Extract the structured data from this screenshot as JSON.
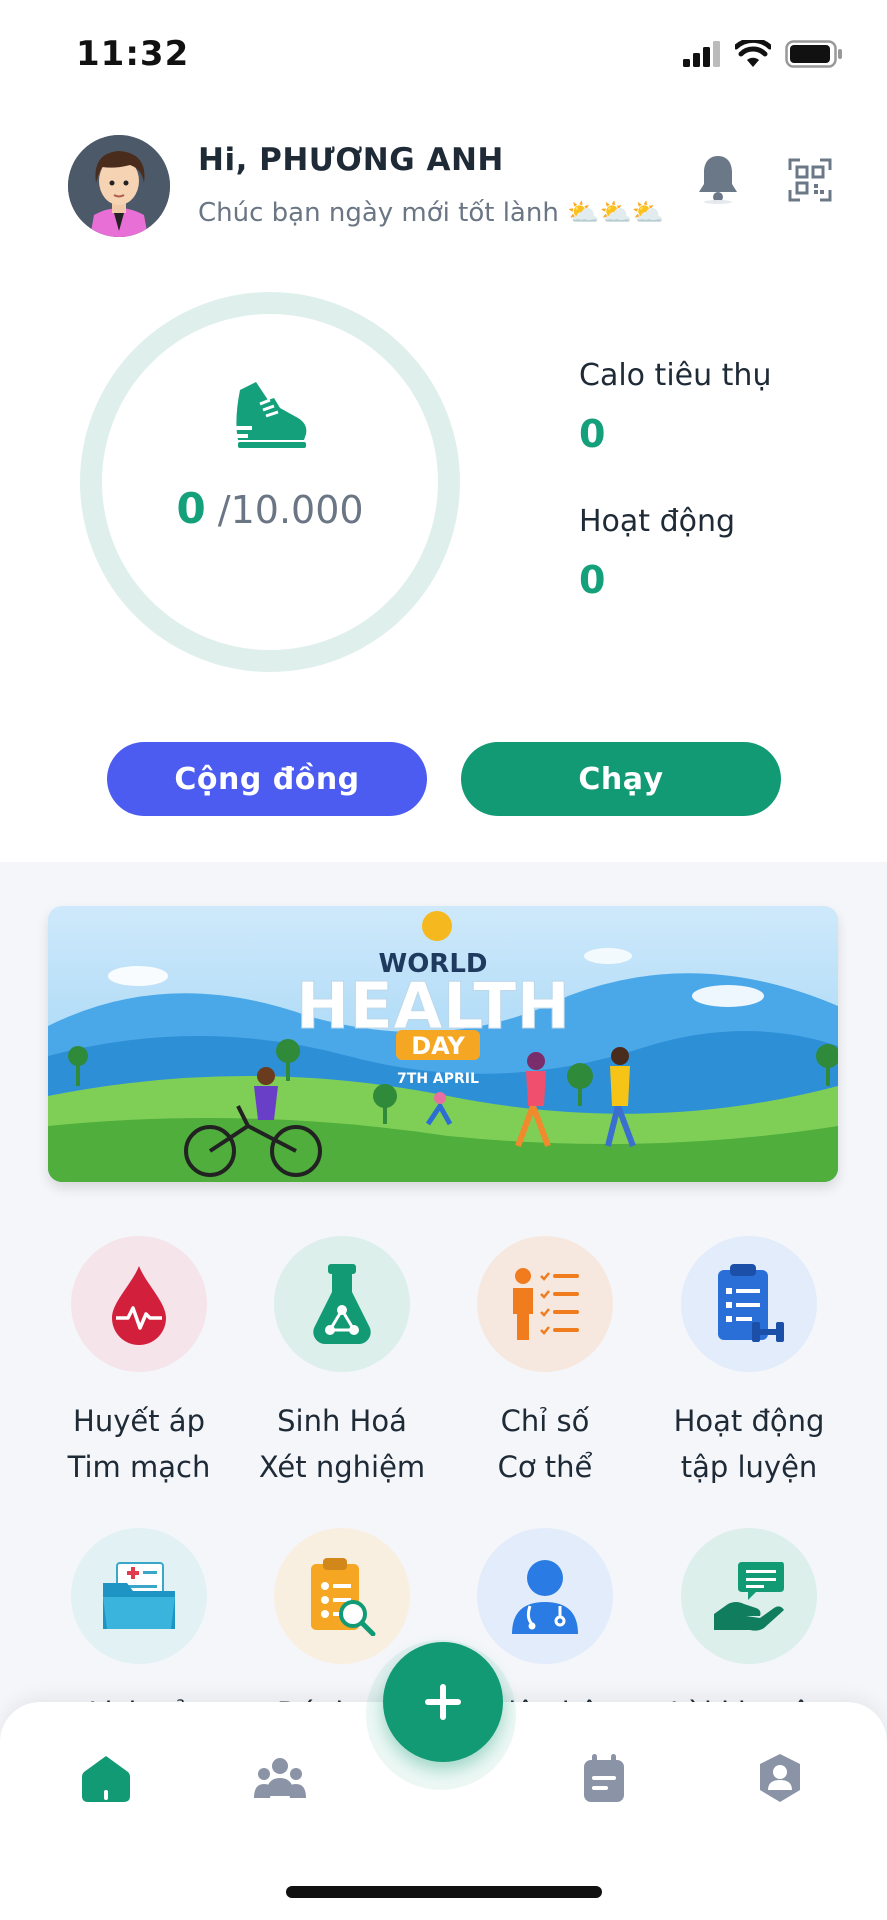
{
  "status_bar": {
    "time": "11:32"
  },
  "header": {
    "greeting": "Hi, PHƯƠNG ANH",
    "subtitle": "Chúc bạn ngày mới tốt lành ⛅⛅⛅"
  },
  "activity": {
    "steps_current": "0",
    "steps_goal": "/10.000",
    "steps_progress": 0,
    "calories_label": "Calo tiêu thụ",
    "calories_value": "0",
    "activity_label": "Hoạt động",
    "activity_value": "0"
  },
  "actions": {
    "community": "Cộng đồng",
    "run": "Chạy"
  },
  "banner": {
    "line1": "WORLD",
    "line2": "HEALTH",
    "line3": "DAY",
    "line4": "7TH APRIL"
  },
  "tiles": [
    {
      "line1": "Huyết áp",
      "line2": "Tim mạch",
      "icon": "blood-drop-icon",
      "bg": "#f5e4ea"
    },
    {
      "line1": "Sinh Hoá",
      "line2": "Xét nghiệm",
      "icon": "flask-icon",
      "bg": "#dcefea"
    },
    {
      "line1": "Chỉ số",
      "line2": "Cơ thể",
      "icon": "body-index-icon",
      "bg": "#f7e8df"
    },
    {
      "line1": "Hoạt động",
      "line2": "tập luyện",
      "icon": "clipboard-workout-icon",
      "bg": "#e2ecfb"
    },
    {
      "line1": "Lịch sử",
      "icon": "medical-folder-icon",
      "bg": "#e1f1f4"
    },
    {
      "line1": "Đánh giá",
      "icon": "assessment-icon",
      "bg": "#f8efe0"
    },
    {
      "line1": "Liên hệ",
      "icon": "doctor-icon",
      "bg": "#e2ecfb"
    },
    {
      "line1": "Lời khuyên",
      "icon": "advice-icon",
      "bg": "#dcefea"
    }
  ],
  "colors": {
    "primary_green": "#129a74",
    "primary_blue": "#4c5cf0"
  }
}
